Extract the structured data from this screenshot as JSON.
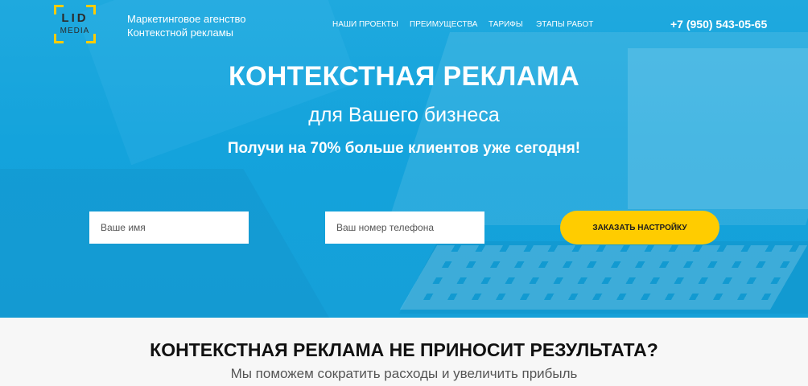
{
  "header": {
    "logo_top": "LID",
    "logo_bottom": "MEDIA",
    "tagline_line1": "Маркетинговое агенство",
    "tagline_line2": "Контекстной рекламы",
    "nav": [
      "Наши проекты",
      "Преимущества",
      "Тарифы",
      "Этапы работ"
    ],
    "phone": "+7 (950) 543-05-65"
  },
  "hero": {
    "title": "КОНТЕКСТНАЯ РЕКЛАМА",
    "subtitle": "для Вашего бизнеса",
    "offer": "Получи на 70% больше клиентов уже сегодня!",
    "form": {
      "name_placeholder": "Ваше имя",
      "phone_placeholder": "Ваш номер телефона",
      "submit_label": "Заказать настройку"
    }
  },
  "section": {
    "title": "КОНТЕКСТНАЯ РЕКЛАМА НЕ ПРИНОСИТ РЕЗУЛЬТАТА?",
    "subtitle": "Мы поможем сократить расходы и увеличить прибыль"
  },
  "colors": {
    "hero_blue": "#15a3dc",
    "accent_yellow": "#ffcc00"
  }
}
